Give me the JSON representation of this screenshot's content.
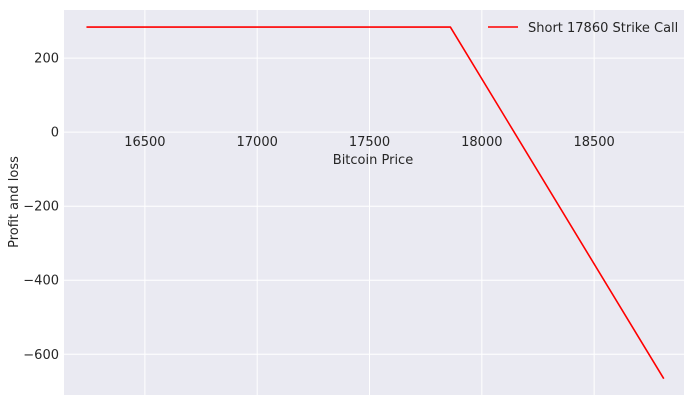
{
  "chart_data": {
    "type": "line",
    "title": "",
    "xlabel": "Bitcoin Price",
    "ylabel": "Profit and loss",
    "xlim": [
      16140,
      18900
    ],
    "ylim": [
      -710,
      330
    ],
    "xticks": [
      16500,
      17000,
      17500,
      18000,
      18500
    ],
    "yticks": [
      200,
      0,
      -200,
      -400,
      -600
    ],
    "xtick_labels": [
      "16500",
      "17000",
      "17500",
      "18000",
      "18500"
    ],
    "ytick_labels": [
      "200",
      "0",
      "−200",
      "−400",
      "−600"
    ],
    "grid": true,
    "legend_position": "top-right",
    "series": [
      {
        "name": "Short 17860 Strike Call",
        "color": "#ff0000",
        "x": [
          16240,
          17860,
          18810
        ],
        "y": [
          284,
          284,
          -666
        ]
      }
    ],
    "background_color": "#eaeaf2",
    "grid_color": "#ffffff"
  }
}
